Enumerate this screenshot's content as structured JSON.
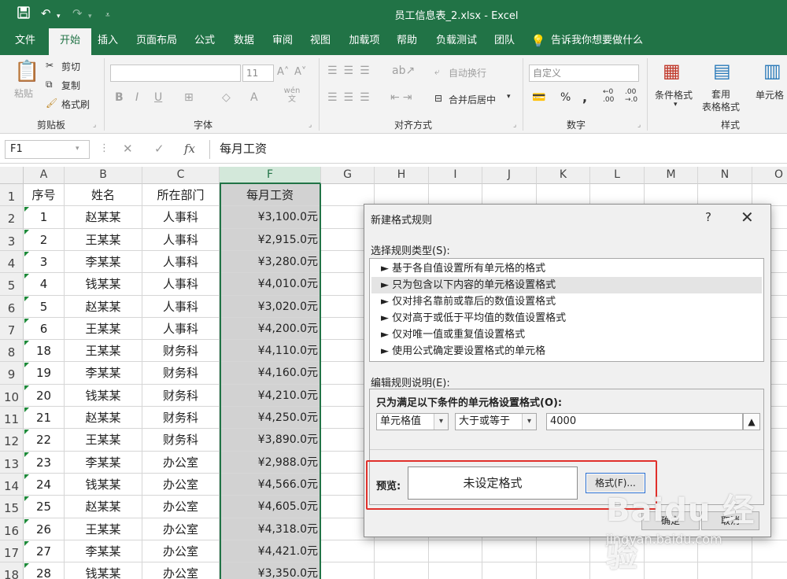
{
  "window": {
    "title": "员工信息表_2.xlsx - Excel"
  },
  "qat": {
    "save": "save-icon",
    "undo": "undo-icon",
    "redo": "redo-icon",
    "customize": "customize-icon"
  },
  "tabs": [
    "文件",
    "开始",
    "插入",
    "页面布局",
    "公式",
    "数据",
    "审阅",
    "视图",
    "加载项",
    "帮助",
    "负载测试",
    "团队",
    "告诉我你想要做什么"
  ],
  "ribbon": {
    "clipboard": {
      "label": "剪贴板",
      "paste": "粘贴",
      "cut": "剪切",
      "copy": "复制",
      "format_painter": "格式刷"
    },
    "font": {
      "label": "字体",
      "font_name": "",
      "font_size": "11",
      "bold": "B",
      "italic": "I",
      "underline": "U",
      "wen": "wén 文"
    },
    "alignment": {
      "label": "对齐方式",
      "wrap_text": "自动换行",
      "merge_center": "合并后居中"
    },
    "number": {
      "label": "数字",
      "format": "自定义",
      "percent": "%",
      "comma": ","
    },
    "styles": {
      "label": "样式",
      "conditional_formatting": "条件格式",
      "format_as_table": "套用\n表格格式",
      "cell_styles": "单元格"
    }
  },
  "formula_bar": {
    "name_box": "F1",
    "fx": "fx",
    "content": "每月工资"
  },
  "grid": {
    "columns": [
      "A",
      "B",
      "C",
      "F",
      "G",
      "H",
      "I",
      "J",
      "K",
      "L",
      "M",
      "N",
      "O"
    ],
    "selected_column": "F",
    "row_numbers": [
      "1",
      "2",
      "3",
      "4",
      "5",
      "6",
      "7",
      "8",
      "9",
      "10",
      "11",
      "12",
      "13",
      "14",
      "15",
      "16",
      "17",
      "18"
    ],
    "header_row": [
      "序号",
      "姓名",
      "所在部门",
      "每月工资"
    ],
    "rows": [
      [
        "1",
        "赵某某",
        "人事科",
        "¥3,100.0元"
      ],
      [
        "2",
        "王某某",
        "人事科",
        "¥2,915.0元"
      ],
      [
        "3",
        "李某某",
        "人事科",
        "¥3,280.0元"
      ],
      [
        "4",
        "钱某某",
        "人事科",
        "¥4,010.0元"
      ],
      [
        "5",
        "赵某某",
        "人事科",
        "¥3,020.0元"
      ],
      [
        "6",
        "王某某",
        "人事科",
        "¥4,200.0元"
      ],
      [
        "18",
        "王某某",
        "财务科",
        "¥4,110.0元"
      ],
      [
        "19",
        "李某某",
        "财务科",
        "¥4,160.0元"
      ],
      [
        "20",
        "钱某某",
        "财务科",
        "¥4,210.0元"
      ],
      [
        "21",
        "赵某某",
        "财务科",
        "¥4,250.0元"
      ],
      [
        "22",
        "王某某",
        "财务科",
        "¥3,890.0元"
      ],
      [
        "23",
        "李某某",
        "办公室",
        "¥2,988.0元"
      ],
      [
        "24",
        "钱某某",
        "办公室",
        "¥4,566.0元"
      ],
      [
        "25",
        "赵某某",
        "办公室",
        "¥4,605.0元"
      ],
      [
        "26",
        "王某某",
        "办公室",
        "¥4,318.0元"
      ],
      [
        "27",
        "李某某",
        "办公室",
        "¥4,421.0元"
      ],
      [
        "28",
        "钱某某",
        "办公室",
        "¥3,350.0元"
      ]
    ]
  },
  "dialog": {
    "title": "新建格式规则",
    "help": "?",
    "close": "✕",
    "rule_type_label": "选择规则类型(S):",
    "rule_types": [
      "► 基于各自值设置所有单元格的格式",
      "► 只为包含以下内容的单元格设置格式",
      "► 仅对排名靠前或靠后的数值设置格式",
      "► 仅对高于或低于平均值的数值设置格式",
      "► 仅对唯一值或重复值设置格式",
      "► 使用公式确定要设置格式的单元格"
    ],
    "selected_rule_index": 1,
    "edit_label": "编辑规则说明(E):",
    "condition_title": "只为满足以下条件的单元格设置格式(O):",
    "condition_field": "单元格值",
    "condition_operator": "大于或等于",
    "condition_value": "4000",
    "preview_label": "预览:",
    "preview_text": "未设定格式",
    "format_button": "格式(F)...",
    "ok_button": "确定",
    "cancel_button": "取消"
  },
  "watermark": {
    "main": "Baidu 经验",
    "url": "jingyan.baidu.com"
  },
  "colors": {
    "accent": "#217346",
    "highlight": "#e0302b",
    "selected_fill": "#d2d2d2"
  }
}
